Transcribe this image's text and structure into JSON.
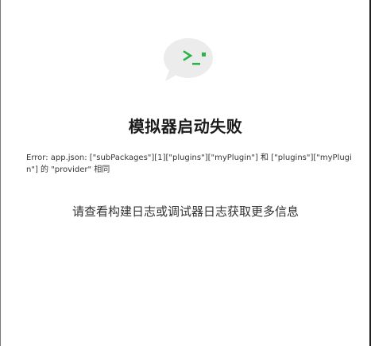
{
  "error_panel": {
    "icon": "terminal-chat-bubble-icon",
    "title": "模拟器启动失败",
    "error_message": "Error: app.json: [\"subPackages\"][1][\"plugins\"][\"myPlugin\"] 和 [\"plugins\"][\"myPlugin\"] 的 \"provider\" 相同",
    "hint": "请查看构建日志或调试器日志获取更多信息"
  },
  "colors": {
    "bubble": "#ececec",
    "prompt_green": "#2bb44a",
    "title": "#1b1b1b",
    "text": "#333333"
  }
}
